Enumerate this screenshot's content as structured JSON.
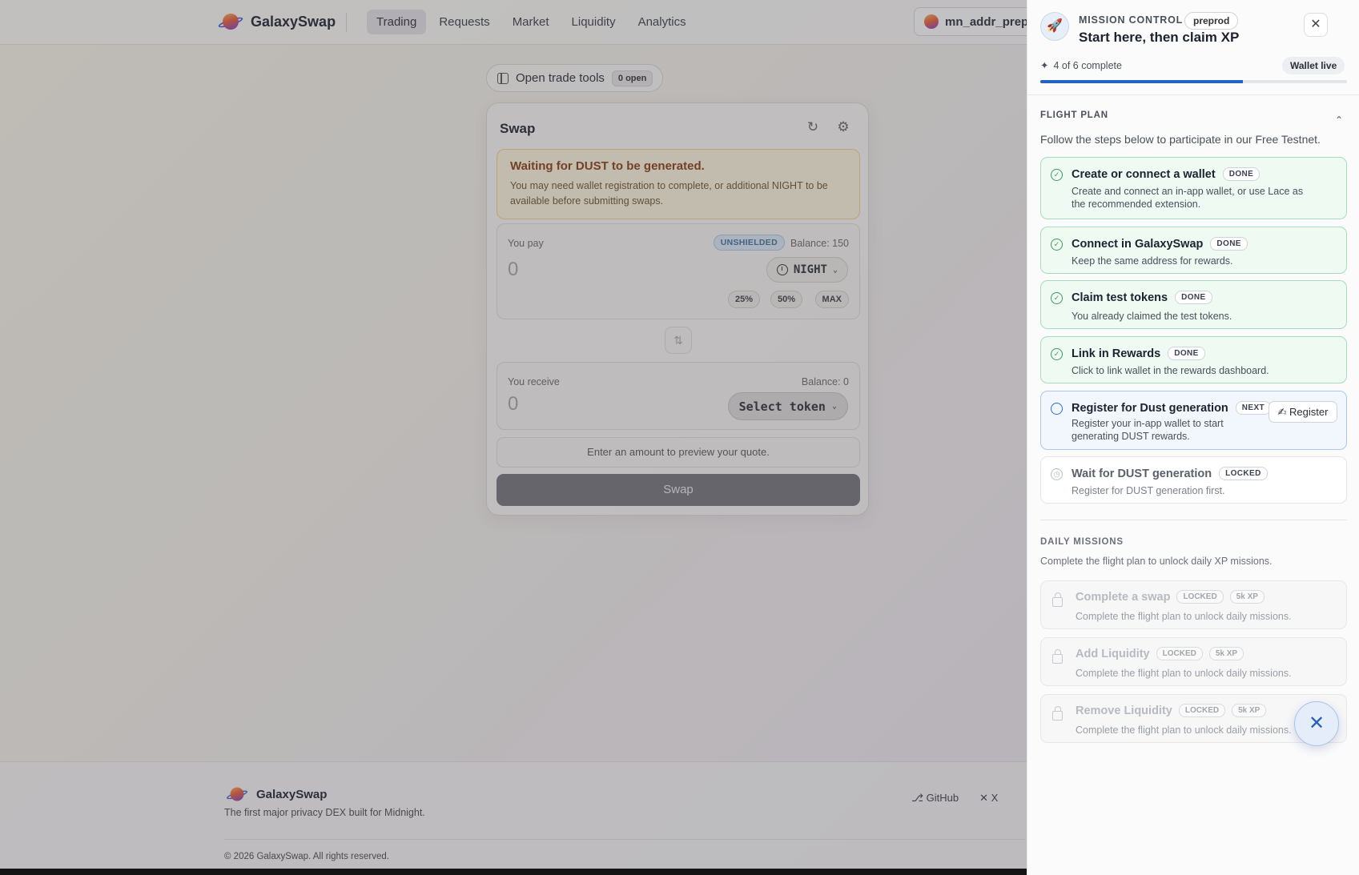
{
  "header": {
    "brand": "GalaxySwap",
    "nav": [
      "Trading",
      "Requests",
      "Market",
      "Liquidity",
      "Analytics"
    ],
    "active_nav": "Trading",
    "wallet_address": "mn_addr_prepr"
  },
  "tools": {
    "label": "Open trade tools",
    "count": "0 open"
  },
  "swap": {
    "title": "Swap",
    "warning_title": "Waiting for DUST to be generated.",
    "warning_text": "You may need wallet registration to complete, or additional NIGHT to be available before submitting swaps.",
    "pay": {
      "label": "You pay",
      "badge": "UNSHIELDED",
      "balance": "Balance: 150",
      "amount": "0",
      "token": "NIGHT",
      "presets": [
        "25%",
        "50%",
        "MAX"
      ]
    },
    "receive": {
      "label": "You receive",
      "balance": "Balance: 0",
      "amount": "0",
      "token": "Select token"
    },
    "quote_hint": "Enter an amount to preview your quote.",
    "button": "Swap"
  },
  "footer": {
    "brand": "GalaxySwap",
    "tagline": "The first major privacy DEX built for Midnight.",
    "links": [
      "GitHub",
      "X"
    ],
    "copyright": "© 2026 GalaxySwap. All rights reserved."
  },
  "panel": {
    "kicker": "MISSION CONTROL",
    "env_badge": "preprod",
    "title": "Start here, then claim XP",
    "progress_text": "4 of 6 complete",
    "progress_fraction": 0.66,
    "wallet_status": "Wallet live",
    "flight_plan": {
      "heading": "FLIGHT PLAN",
      "subtitle": "Follow the steps below to participate in our Free Testnet.",
      "steps": [
        {
          "title": "Create or connect a wallet",
          "status": "DONE",
          "desc": "Create and connect an in-app wallet, or use Lace as the recommended extension."
        },
        {
          "title": "Connect in GalaxySwap",
          "status": "DONE",
          "desc": "Keep the same address for rewards."
        },
        {
          "title": "Claim test tokens",
          "status": "DONE",
          "desc": "You already claimed the test tokens."
        },
        {
          "title": "Link in Rewards",
          "status": "DONE",
          "desc": "Click to link wallet in the rewards dashboard."
        },
        {
          "title": "Register for Dust generation",
          "status": "NEXT",
          "desc": "Register your in-app wallet to start generating DUST rewards.",
          "action": "Register"
        },
        {
          "title": "Wait for DUST generation",
          "status": "LOCKED",
          "desc": "Register for DUST generation first."
        }
      ]
    },
    "daily": {
      "heading": "DAILY MISSIONS",
      "subtitle": "Complete the flight plan to unlock daily XP missions.",
      "missions": [
        {
          "title": "Complete a swap",
          "status": "LOCKED",
          "xp": "5k XP",
          "desc": "Complete the flight plan to unlock daily missions."
        },
        {
          "title": "Add Liquidity",
          "status": "LOCKED",
          "xp": "5k XP",
          "desc": "Complete the flight plan to unlock daily missions."
        },
        {
          "title": "Remove Liquidity",
          "status": "LOCKED",
          "xp": "5k XP",
          "desc": "Complete the flight plan to unlock daily missions."
        }
      ]
    }
  },
  "colors": {
    "accent": "#2462c4",
    "done": "#3a9a62",
    "warning_bg": "#fbf3dc"
  }
}
